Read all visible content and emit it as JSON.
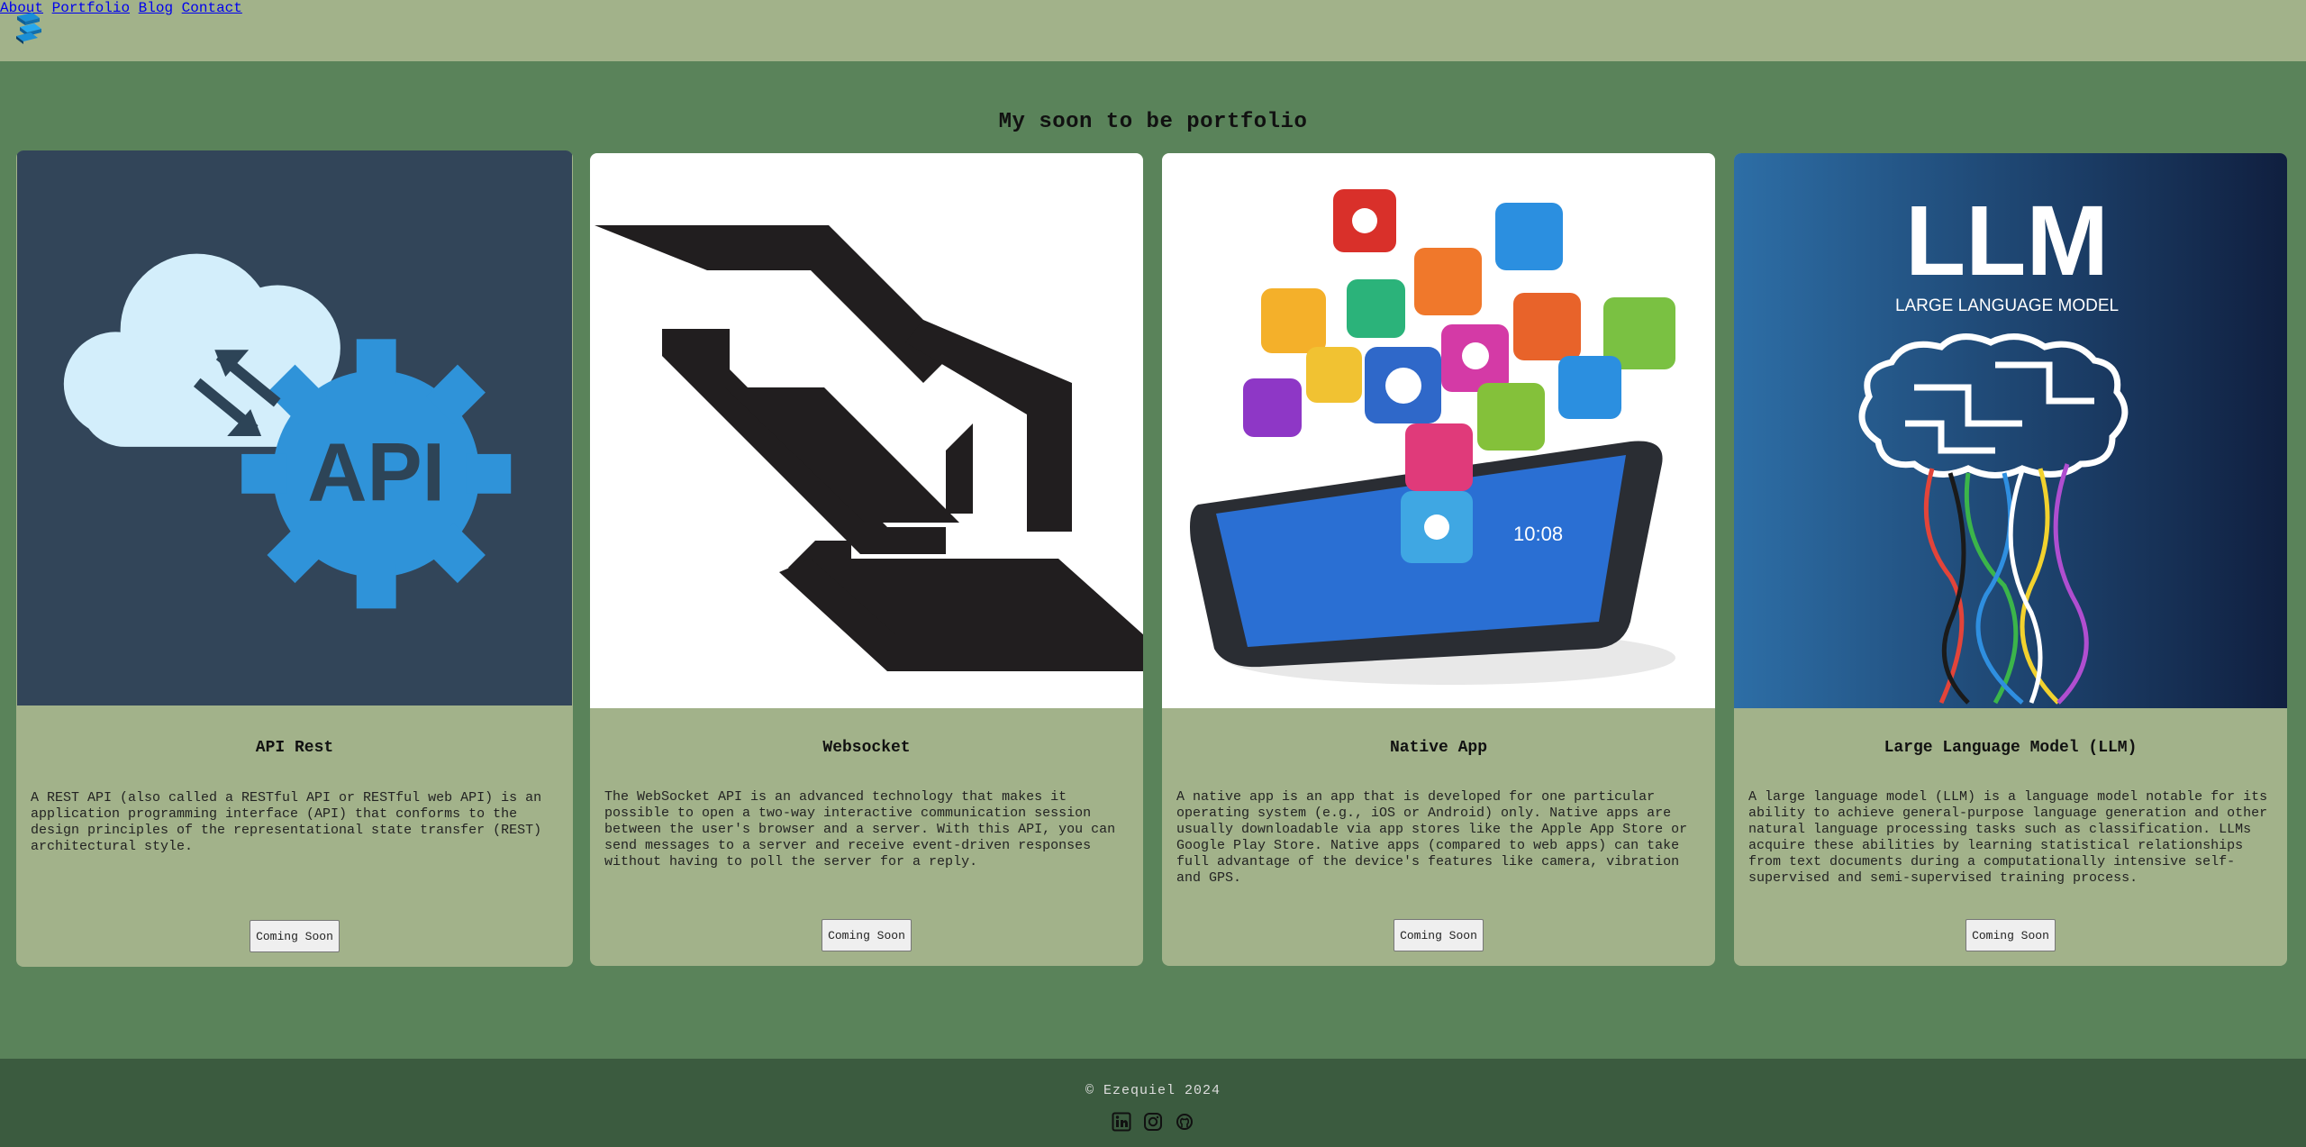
{
  "header": {
    "logo_icon": "stacked-blocks-logo-icon",
    "nav": [
      "About",
      "Portfolio",
      "Blog",
      "Contact"
    ]
  },
  "main": {
    "title": "My soon to be portfolio",
    "cards": [
      {
        "image_icon": "api-cloud-gear-illustration",
        "image_text": "API",
        "title": "API Rest",
        "description": "A REST API (also called a RESTful API or RESTful web API) is an application programming interface (API) that conforms to the design principles of the representational state transfer (REST) architectural style.",
        "button": "Coming Soon"
      },
      {
        "image_icon": "websocket-logo-illustration",
        "title": "Websocket",
        "description": "The WebSocket API is an advanced technology that makes it possible to open a two-way interactive communication session between the user's browser and a server. With this API, you can send messages to a server and receive event-driven responses without having to poll the server for a reply.",
        "button": "Coming Soon"
      },
      {
        "image_icon": "tablet-with-app-icons-illustration",
        "image_text": "10:08",
        "title": "Native App",
        "description": "A native app is an app that is developed for one particular operating system (e.g., iOS or Android) only. Native apps are usually downloadable via app stores like the Apple App Store or Google Play Store. Native apps (compared to web apps) can take full advantage of the device's features like camera, vibration and GPS.",
        "button": "Coming Soon"
      },
      {
        "image_icon": "llm-brain-illustration",
        "image_title": "LLM",
        "image_subtitle": "LARGE LANGUAGE MODEL",
        "title": "Large Language Model (LLM)",
        "description": "A large language model (LLM) is a language model notable for its ability to achieve general-purpose language generation and other natural language processing tasks such as classification. LLMs acquire these abilities by learning statistical relationships from text documents during a computationally intensive self-supervised and semi-supervised training process.",
        "button": "Coming Soon"
      }
    ]
  },
  "footer": {
    "copyright": "© Ezequiel 2024",
    "social_icons": [
      "linkedin-icon",
      "instagram-icon",
      "github-icon"
    ]
  },
  "colors": {
    "page_bg": "#5a835a",
    "header_bg": "#a2b28a",
    "card_bg": "#a2b28a",
    "footer_bg": "#3b5b3f"
  }
}
